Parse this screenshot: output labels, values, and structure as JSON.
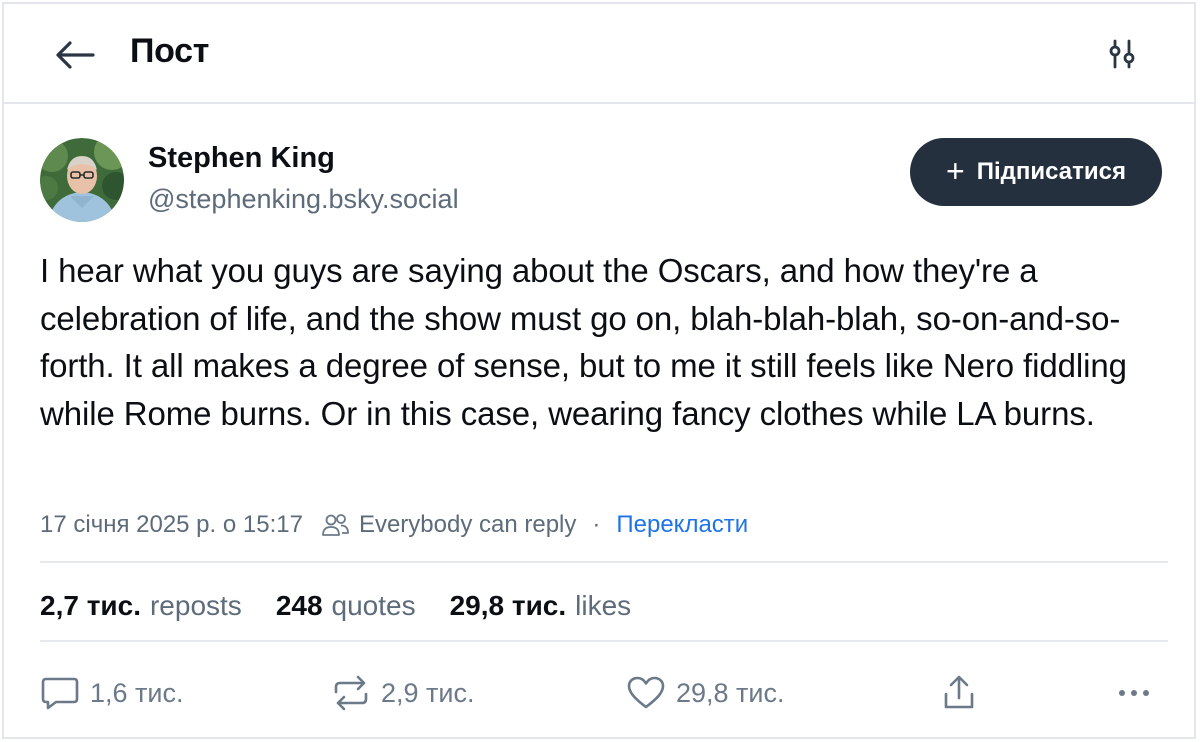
{
  "header": {
    "title": "Пост",
    "back_icon": "arrow-left-icon",
    "filter_icon": "settings-sliders-icon"
  },
  "author": {
    "name": "Stephen King",
    "handle": "@stephenking.bsky.social",
    "follow_label": "Підписатися"
  },
  "post": {
    "text": "I hear what you guys are saying about the Oscars, and how they're a celebration of life, and the show must go on, blah-blah-blah, so-on-and-so-forth. It all makes a degree of sense, but to me it still feels like Nero fiddling while Rome burns. Or in this case, wearing fancy clothes while LA burns.",
    "timestamp": "17 січня 2025 р. о 15:17",
    "reply_setting": "Everybody can reply",
    "separator": "·",
    "translate_label": "Перекласти"
  },
  "stats": {
    "reposts_count": "2,7 тис.",
    "reposts_label": "reposts",
    "quotes_count": "248",
    "quotes_label": "quotes",
    "likes_count": "29,8 тис.",
    "likes_label": "likes"
  },
  "actions": {
    "reply_count": "1,6 тис.",
    "repost_count": "2,9 тис.",
    "like_count": "29,8 тис."
  },
  "colors": {
    "text": "#0b0f14",
    "muted": "#5d6b7a",
    "link": "#1e73e8",
    "follow_bg": "#25303e",
    "divider": "#e6e9ed"
  }
}
